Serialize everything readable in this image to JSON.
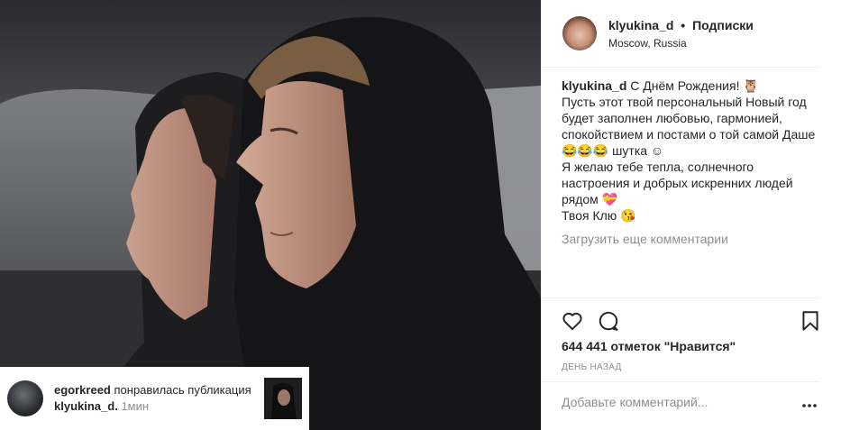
{
  "post": {
    "username": "klyukina_d",
    "separator": "•",
    "follow_label": "Подписки",
    "location": "Moscow, Russia",
    "caption_lines": [
      "С Днём Рождения! 🦉",
      "Пусть этот твой персональный Новый год будет заполнен любовью, гармонией, спокойствием и постами о той самой Даше 😂😂😂 шутка ☺",
      "Я желаю тебе тепла, солнечного настроения и добрых искренних людей рядом 💝",
      "Твоя Клю 😘"
    ],
    "load_more": "Загрузить еще комментарии",
    "likes": "644 441 отметок \"Нравится\"",
    "date": "ДЕНЬ НАЗАД",
    "comment_placeholder": "Добавьте комментарий..."
  },
  "notification": {
    "user": "egorkreed",
    "text_before": "понравилась публикация",
    "target": "klyukina_d.",
    "time": "1мин"
  },
  "icons": {
    "like": "heart-outline-icon",
    "comment": "comment-bubble-icon",
    "save": "bookmark-icon",
    "more": "more-dots-icon"
  }
}
